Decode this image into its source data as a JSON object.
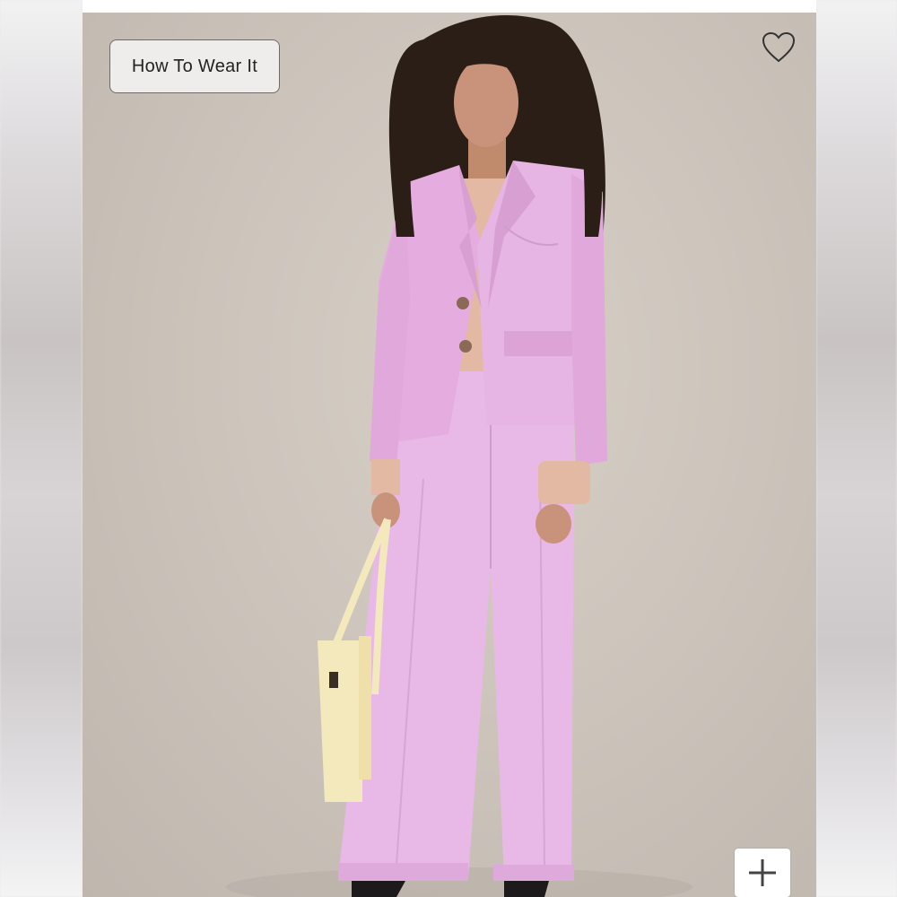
{
  "product_image": {
    "how_to_wear_label": "How To Wear It",
    "favorite_icon": "heart-icon",
    "zoom_icon": "plus-icon"
  },
  "colors": {
    "suit": "#e7b5e3",
    "sweater": "#e3b9a3",
    "bag": "#f3e9bd",
    "backdrop": "#cdc5bc"
  }
}
